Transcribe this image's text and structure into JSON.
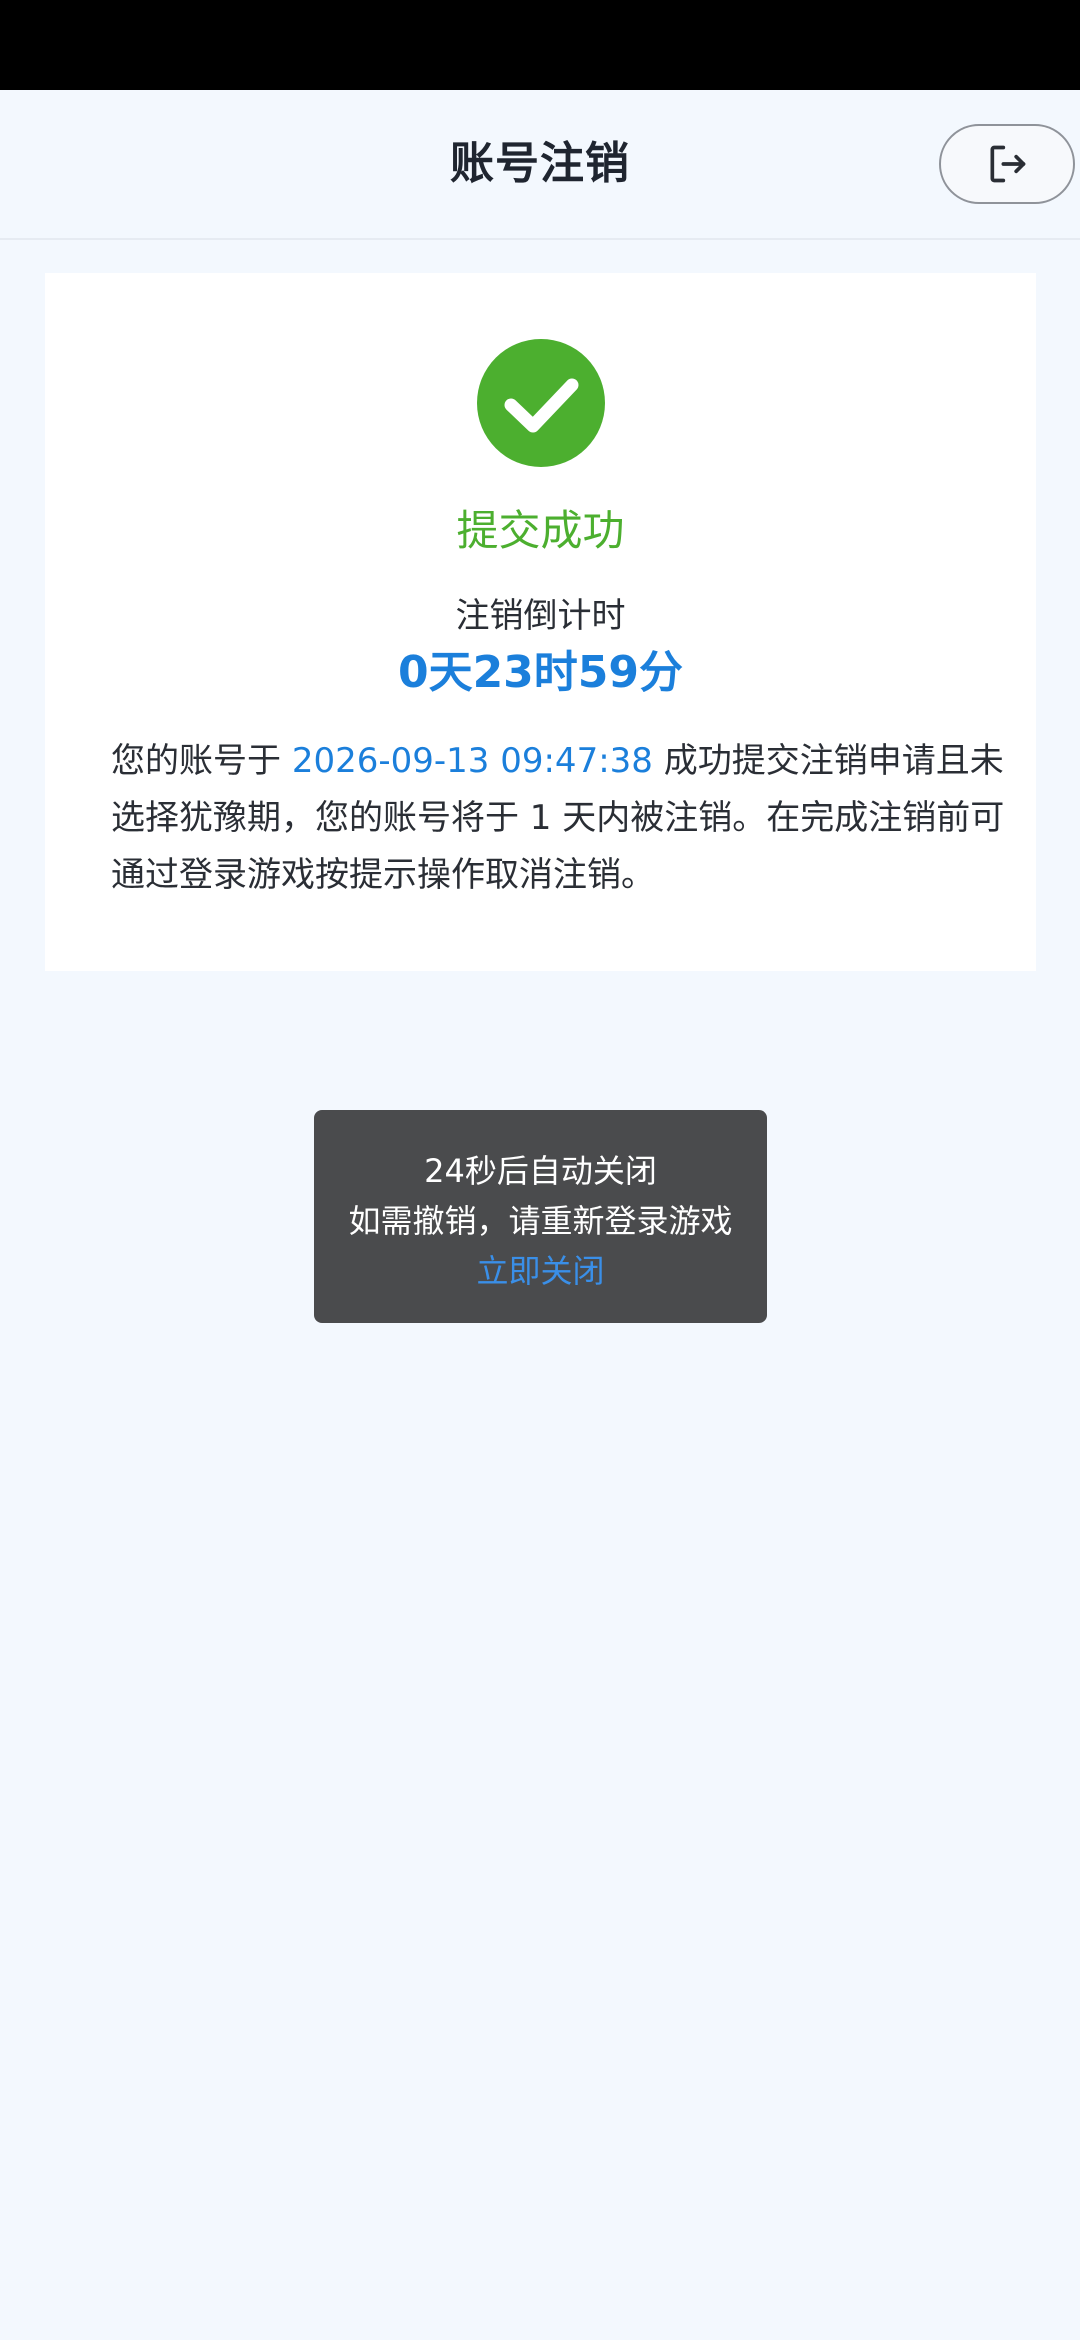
{
  "header": {
    "title": "账号注销",
    "logout_icon": "logout-icon"
  },
  "card": {
    "icon": "check-circle-icon",
    "success_title": "提交成功",
    "countdown_label": "注销倒计时",
    "countdown_value": "0天23时59分",
    "description": {
      "part1": "您的账号于 ",
      "timestamp": "2026-09-13 09:47:38",
      "part2": " 成功提交注销申请且未选择犹豫期，您的账号将于 1 天内被注销。在完成注销前可通过登录游戏按提示操作取消注销。"
    }
  },
  "toast": {
    "line1": "24秒后自动关闭",
    "line2": "如需撤销，请重新登录游戏",
    "close_link": "立即关闭"
  },
  "colors": {
    "success_green": "#4caf2f",
    "accent_blue": "#1b7fdb",
    "background": "#f3f8fe"
  }
}
